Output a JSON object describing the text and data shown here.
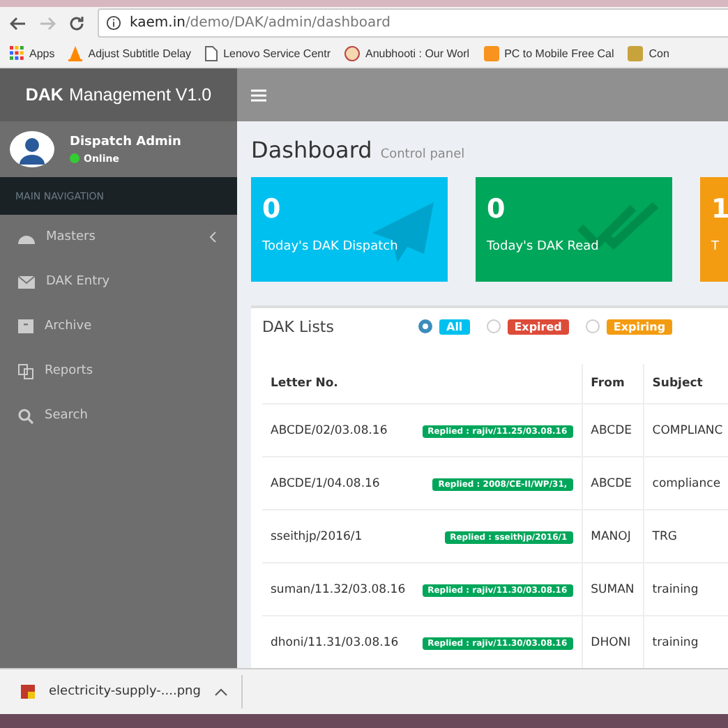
{
  "browser": {
    "url_host": "kaem.in",
    "url_path": "/demo/DAK/admin/dashboard",
    "bookmarks": [
      {
        "label": "Apps",
        "kind": "apps"
      },
      {
        "label": "Adjust Subtitle Delay",
        "kind": "cone"
      },
      {
        "label": "Lenovo Service Centr",
        "kind": "page"
      },
      {
        "label": "Anubhooti : Our Worl",
        "kind": "face"
      },
      {
        "label": "PC to Mobile Free Cal",
        "kind": "orange"
      },
      {
        "label": "Con",
        "kind": "badge"
      }
    ]
  },
  "app": {
    "brand_bold": "DAK",
    "brand_rest": "Management V1.0",
    "user": {
      "name": "Dispatch Admin",
      "status": "Online",
      "online": true
    },
    "nav_header": "MAIN NAVIGATION",
    "nav": [
      {
        "label": "Masters",
        "kind": "gauge",
        "expandable": true
      },
      {
        "label": "DAK Entry",
        "kind": "envelope",
        "expandable": false
      },
      {
        "label": "Archive",
        "kind": "archive",
        "expandable": false
      },
      {
        "label": "Reports",
        "kind": "copy",
        "expandable": false
      },
      {
        "label": "Search",
        "kind": "search",
        "expandable": false
      }
    ]
  },
  "page": {
    "title": "Dashboard",
    "subtitle": "Control panel"
  },
  "cards": [
    {
      "value": "0",
      "label": "Today's DAK Dispatch",
      "color": "#00c0ef",
      "kind": "plane"
    },
    {
      "value": "0",
      "label": "Today's DAK Read",
      "color": "#00a65a",
      "kind": "check"
    },
    {
      "value": "1",
      "label": "T",
      "color": "#f39c12",
      "kind": "other"
    }
  ],
  "dak_lists": {
    "title": "DAK Lists",
    "filters": [
      {
        "label": "All",
        "selected": true,
        "color": "#00c0ef"
      },
      {
        "label": "Expired",
        "selected": false,
        "color": "#dd4b39"
      },
      {
        "label": "Expiring",
        "selected": false,
        "color": "#f39c12"
      }
    ],
    "columns": [
      "Letter No.",
      "From",
      "Subject"
    ],
    "rows": [
      {
        "letter": "ABCDE/02/03.08.16",
        "status": "Replied : rajiv/11.25/03.08.16",
        "from": "ABCDE",
        "subject": "COMPLIANC"
      },
      {
        "letter": "ABCDE/1/04.08.16",
        "status": "Replied : 2008/CE-II/WP/31,",
        "from": "ABCDE",
        "subject": "compliance"
      },
      {
        "letter": "sseithjp/2016/1",
        "status": "Replied : sseithjp/2016/1",
        "from": "MANOJ",
        "subject": "TRG"
      },
      {
        "letter": "suman/11.32/03.08.16",
        "status": "Replied : rajiv/11.30/03.08.16",
        "from": "SUMAN",
        "subject": "training"
      },
      {
        "letter": "dhoni/11.31/03.08.16",
        "status": "Replied : rajiv/11.30/03.08.16",
        "from": "DHONI",
        "subject": "training"
      }
    ]
  },
  "downloads": [
    {
      "name": "electricity-supply-....png"
    }
  ]
}
